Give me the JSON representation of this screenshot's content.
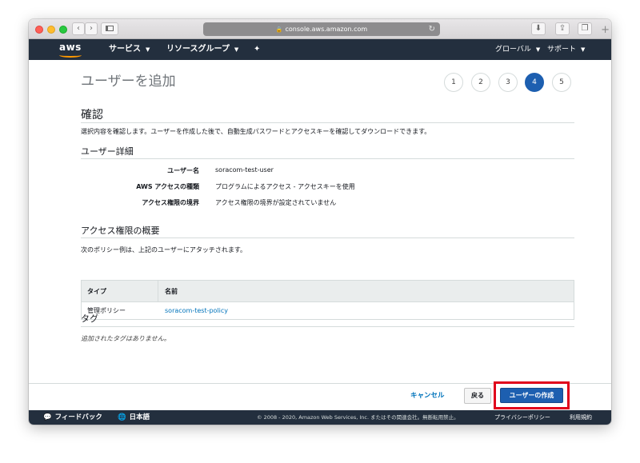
{
  "browser": {
    "url": "console.aws.amazon.com"
  },
  "nav": {
    "logo": "aws",
    "services": "サービス",
    "resource_groups": "リソースグループ",
    "region": "グローバル",
    "support": "サポート"
  },
  "page": {
    "title": "ユーザーを追加",
    "steps": [
      "1",
      "2",
      "3",
      "4",
      "5"
    ],
    "active_step": "4"
  },
  "review": {
    "heading": "確認",
    "description": "選択内容を確認します。ユーザーを作成した後で、自動生成パスワードとアクセスキーを確認してダウンロードできます。"
  },
  "user_details": {
    "heading": "ユーザー詳細",
    "rows": [
      {
        "label": "ユーザー名",
        "value": "soracom-test-user"
      },
      {
        "label": "AWS アクセスの種類",
        "value": "プログラムによるアクセス - アクセスキーを使用"
      },
      {
        "label": "アクセス権限の境界",
        "value": "アクセス権限の境界が設定されていません"
      }
    ]
  },
  "permissions": {
    "heading": "アクセス権限の概要",
    "description": "次のポリシー例は、上記のユーザーにアタッチされます。",
    "columns": [
      "タイプ",
      "名前"
    ],
    "rows": [
      {
        "type": "管理ポリシー",
        "name": "soracom-test-policy"
      }
    ]
  },
  "tags": {
    "heading": "タグ",
    "empty": "追加されたタグはありません。"
  },
  "actions": {
    "cancel": "キャンセル",
    "back": "戻る",
    "create": "ユーザーの作成"
  },
  "footer": {
    "feedback": "フィードバック",
    "language": "日本語",
    "copyright": "© 2008 - 2020, Amazon Web Services, Inc. またはその関連会社。無断転用禁止。",
    "privacy": "プライバシーポリシー",
    "terms": "利用規約"
  },
  "colors": {
    "nav_bg": "#232f3e",
    "primary": "#1d5fb0",
    "link": "#0073bb",
    "highlight": "#e0001b",
    "aws_orange": "#ff9900"
  }
}
